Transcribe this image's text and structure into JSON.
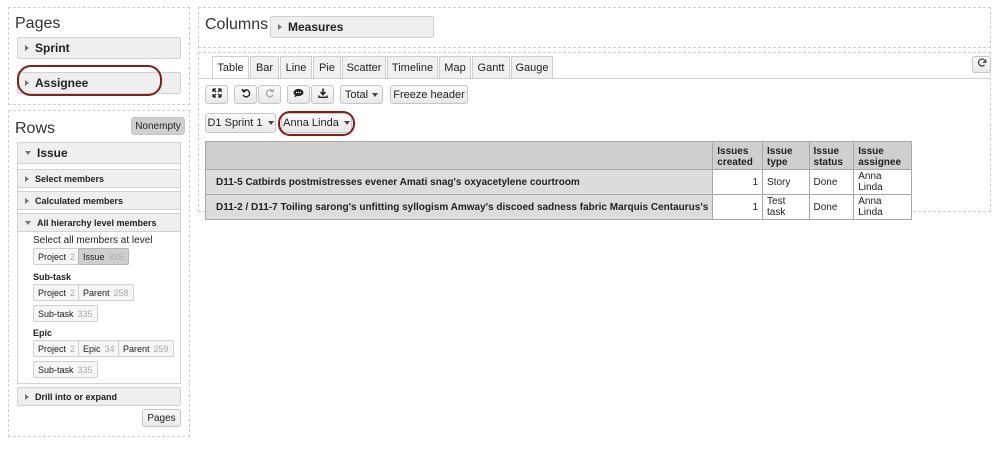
{
  "pages": {
    "title": "Pages",
    "sprint_label": "Sprint",
    "assignee_label": "Assignee"
  },
  "rows": {
    "title": "Rows",
    "nonempty_button": "Nonempty",
    "issue_label": "Issue",
    "select_members": "Select members",
    "calculated_members": "Calculated members",
    "all_hierarchy": "All hierarchy level members",
    "select_all_text": "Select all members at level",
    "level_chips": [
      {
        "label": "Project",
        "count": "2"
      },
      {
        "label": "Issue",
        "count": "335"
      }
    ],
    "subtask_heading": "Sub-task",
    "subtask_chips": [
      {
        "label": "Project",
        "count": "2"
      },
      {
        "label": "Parent",
        "count": "258"
      },
      {
        "label": "Sub-task",
        "count": "335"
      }
    ],
    "epic_heading": "Epic",
    "epic_chips": [
      {
        "label": "Project",
        "count": "2"
      },
      {
        "label": "Epic",
        "count": "34"
      },
      {
        "label": "Parent",
        "count": "259"
      },
      {
        "label": "Sub-task",
        "count": "335"
      }
    ],
    "drill_label": "Drill into or expand",
    "pages_button": "Pages"
  },
  "columns": {
    "title": "Columns",
    "measures_label": "Measures"
  },
  "tabs": [
    "Table",
    "Bar",
    "Line",
    "Pie",
    "Scatter",
    "Timeline",
    "Map",
    "Gantt",
    "Gauge"
  ],
  "toolbar": {
    "expand_icon": "expand-icon",
    "undo_icon": "undo-icon",
    "redo_icon": "redo-icon",
    "comment_icon": "comment-icon",
    "download_icon": "download-icon",
    "total_label": "Total",
    "freeze_label": "Freeze header",
    "refresh_icon": "refresh-icon"
  },
  "filters": {
    "sprint_value": "D1 Sprint 1",
    "assignee_value": "Anna Linda"
  },
  "table": {
    "headers": [
      "Issues created",
      "Issue type",
      "Issue status",
      "Issue assignee"
    ],
    "rows": [
      {
        "name": "D11-5 Catbirds postmistresses evener Amati snag's oxyacetylene courtroom",
        "created": "1",
        "type": "Story",
        "status": "Done",
        "assignee": "Anna Linda"
      },
      {
        "name": "D11-2 / D11-7 Toiling sarong's unfitting syllogism Amway's discoed sadness fabric Marquis Centaurus's",
        "created": "1",
        "type": "Test task",
        "status": "Done",
        "assignee": "Anna Linda"
      }
    ]
  },
  "colors": {
    "highlight_oval": "#8b1b1b",
    "header_bg": "#cfcfcf",
    "rowhead_bg": "#dcdcdc"
  }
}
